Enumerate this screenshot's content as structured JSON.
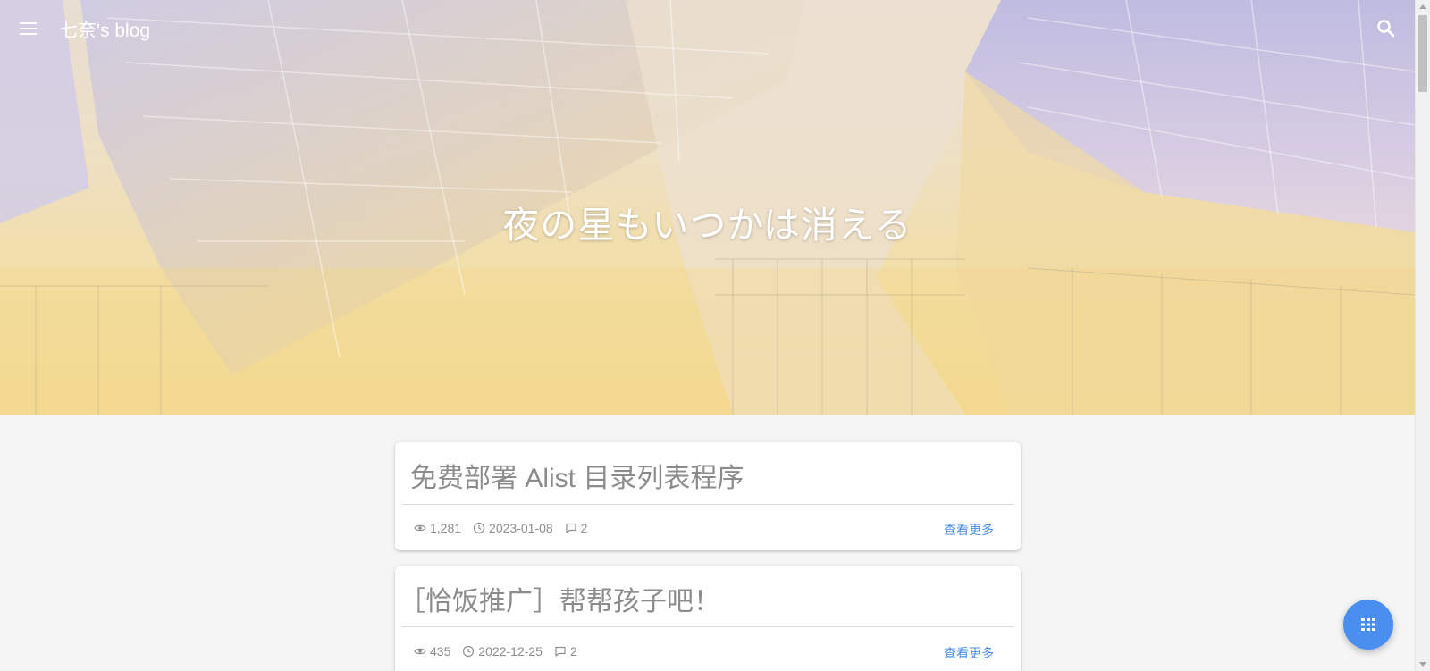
{
  "header": {
    "site_title": "七奈's blog",
    "menu_icon": "hamburger-menu-icon",
    "search_icon": "search-icon"
  },
  "hero": {
    "title": "夜の星もいつかは消える"
  },
  "posts": [
    {
      "title": "免费部署 Alist 目录列表程序",
      "views": "1,281",
      "date": "2023-01-08",
      "comments": "2",
      "read_more": "查看更多"
    },
    {
      "title": "［恰饭推广］帮帮孩子吧！",
      "views": "435",
      "date": "2022-12-25",
      "comments": "2",
      "read_more": "查看更多"
    }
  ],
  "fab": {
    "icon": "apps-grid-icon"
  },
  "colors": {
    "accent": "#4a8ff0",
    "link": "#4a8fe7",
    "background": "#f5f5f5"
  }
}
